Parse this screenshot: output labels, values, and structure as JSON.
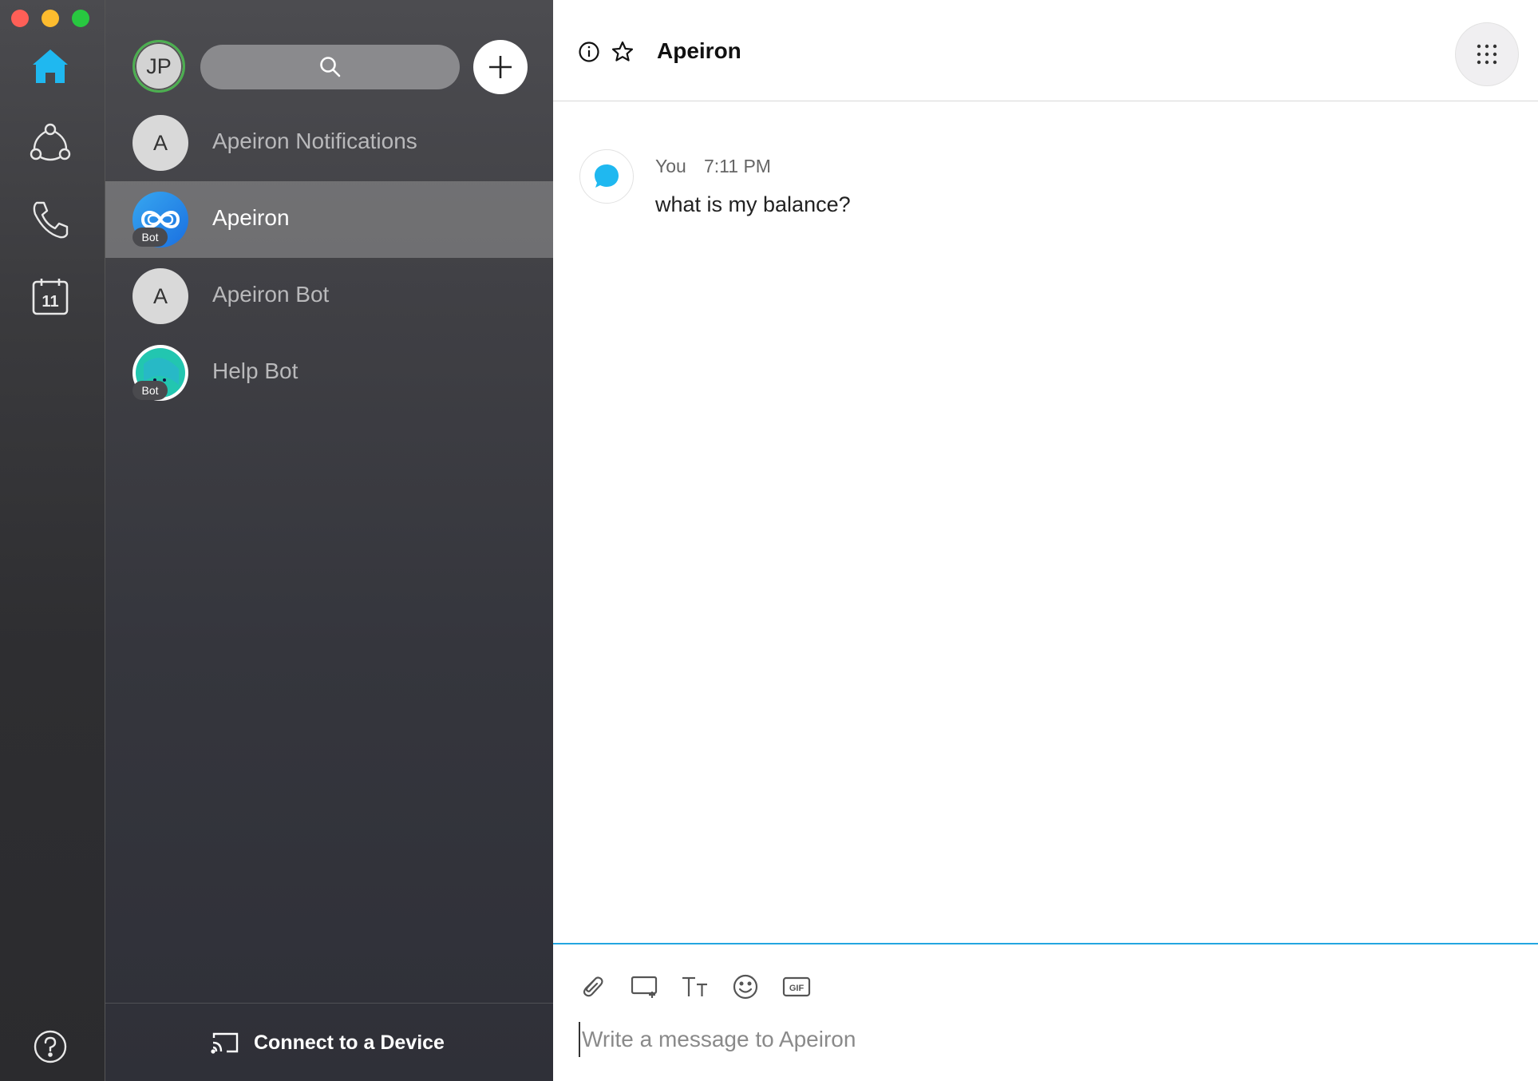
{
  "colors": {
    "accent": "#24a6e0",
    "home_icon": "#1fb8f0",
    "selected_row": "#8b8b8e"
  },
  "rail": {
    "items": [
      {
        "name": "home",
        "icon": "home-icon",
        "active": true
      },
      {
        "name": "teams",
        "icon": "teams-icon"
      },
      {
        "name": "calls",
        "icon": "phone-icon"
      },
      {
        "name": "meetings",
        "icon": "calendar-icon",
        "label": "11"
      }
    ],
    "help_icon": "help-icon"
  },
  "list": {
    "user_initials": "JP",
    "search_icon": "search-icon",
    "add_icon": "plus-icon",
    "conversations": [
      {
        "name": "Apeiron Notifications",
        "avatar_letter": "A",
        "selected": false
      },
      {
        "name": "Apeiron",
        "bot_badge": "Bot",
        "selected": true
      },
      {
        "name": "Apeiron Bot",
        "avatar_letter": "A",
        "selected": false
      },
      {
        "name": "Help Bot",
        "bot_badge": "Bot",
        "selected": false
      }
    ],
    "connect_label": "Connect to a Device"
  },
  "chat": {
    "title": "Apeiron",
    "messages": [
      {
        "sender": "You",
        "time": "7:11 PM",
        "text": "what is my balance?"
      }
    ],
    "composer_placeholder": "Write a message to Apeiron",
    "tools": [
      "attach-icon",
      "whiteboard-icon",
      "text-format-icon",
      "emoji-icon",
      "gif-icon"
    ],
    "gif_label": "GIF"
  }
}
